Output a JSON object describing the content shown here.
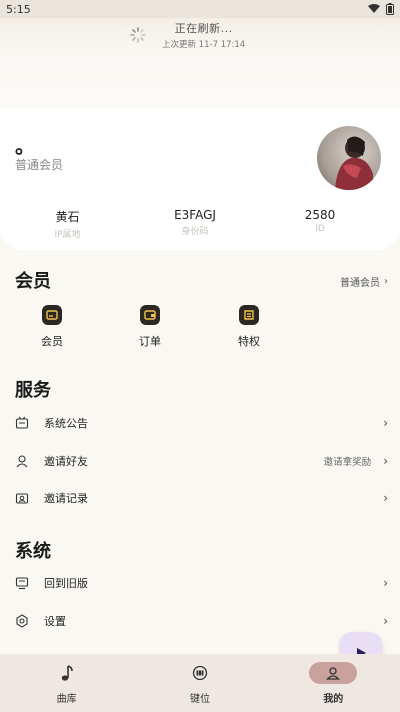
{
  "status": {
    "time": "5:15"
  },
  "refresh": {
    "title": "正在刷新...",
    "subtitle": "上次更新 11-7 17:14"
  },
  "profile": {
    "nickname": "。",
    "level": "普通会员"
  },
  "stats": [
    {
      "value": "黄石",
      "label": "IP属地"
    },
    {
      "value": "E3FAGJ",
      "label": "身份码"
    },
    {
      "value": "2580",
      "label": "ID"
    }
  ],
  "member_section": {
    "title": "会员",
    "badge": "普通会员",
    "items": [
      {
        "label": "会员",
        "icon": "wallet-icon"
      },
      {
        "label": "订单",
        "icon": "order-wallet-icon"
      },
      {
        "label": "特权",
        "icon": "privilege-icon"
      }
    ]
  },
  "service_section": {
    "title": "服务",
    "items": [
      {
        "label": "系统公告",
        "extra": "",
        "icon": "announcement-icon"
      },
      {
        "label": "邀请好友",
        "extra": "邀请拿奖励",
        "icon": "invite-friend-icon"
      },
      {
        "label": "邀请记录",
        "extra": "",
        "icon": "invite-record-icon"
      }
    ]
  },
  "system_section": {
    "title": "系统",
    "items": [
      {
        "label": "回到旧版",
        "icon": "monitor-icon"
      },
      {
        "label": "设置",
        "icon": "settings-icon"
      }
    ]
  },
  "nav": [
    {
      "label": "曲库",
      "icon": "music-note-icon",
      "active": false
    },
    {
      "label": "键位",
      "icon": "keyboard-icon",
      "active": false
    },
    {
      "label": "我的",
      "icon": "person-icon",
      "active": true
    }
  ],
  "colors": {
    "accent": "#c9a19d",
    "fab_bg": "#e8dff7",
    "fab_icon": "#2a1f5c"
  }
}
